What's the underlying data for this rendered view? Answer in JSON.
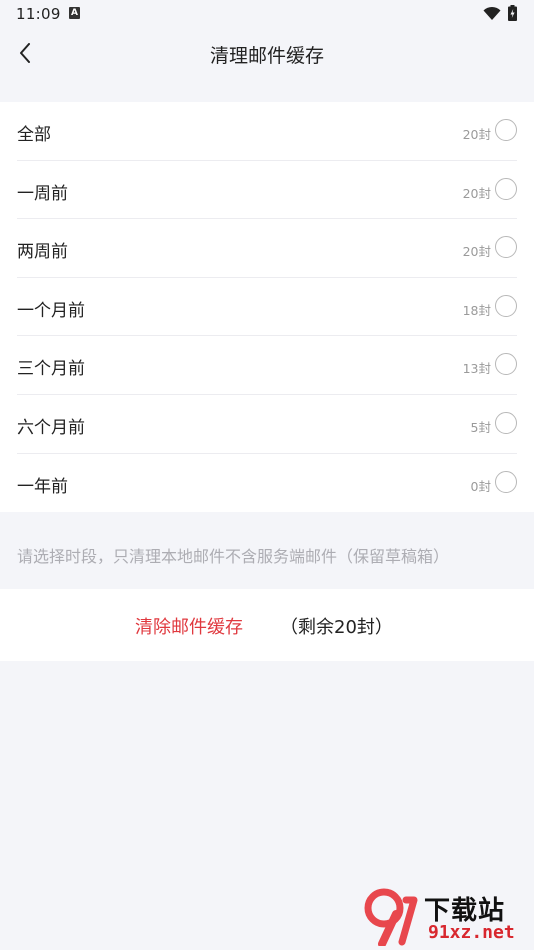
{
  "status_bar": {
    "time": "11:09",
    "notification_icon": "A"
  },
  "header": {
    "title": "清理邮件缓存"
  },
  "options": [
    {
      "label": "全部",
      "count": "20封"
    },
    {
      "label": "一周前",
      "count": "20封"
    },
    {
      "label": "两周前",
      "count": "20封"
    },
    {
      "label": "一个月前",
      "count": "18封"
    },
    {
      "label": "三个月前",
      "count": "13封"
    },
    {
      "label": "六个月前",
      "count": "5封"
    },
    {
      "label": "一年前",
      "count": "0封"
    }
  ],
  "hint": "请选择时段，只清理本地邮件不含服务端邮件（保留草稿箱）",
  "action": {
    "clear_label": "清除邮件缓存",
    "remaining": "（剩余20封）"
  },
  "watermark": {
    "title": "下载站",
    "domain": "91xz.net"
  },
  "colors": {
    "accent": "#e0393f",
    "background": "#f4f5f9",
    "card": "#ffffff",
    "muted_text": "#adadb3"
  }
}
